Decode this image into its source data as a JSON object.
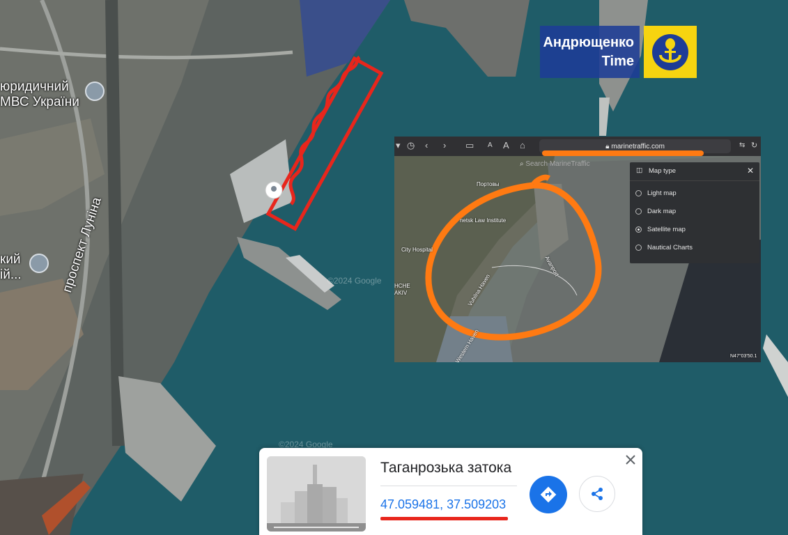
{
  "map": {
    "labels": {
      "institute_line1": "юридичний",
      "institute_line2": "МВС України",
      "partial_line1": "кий",
      "partial_line2": "ій...",
      "street": "проспект Луніна",
      "watermark": "©2024 Google"
    },
    "colors": {
      "water": "#1e5a66",
      "marker": "#e8261c",
      "orange_mark": "#ff7a12"
    }
  },
  "brand": {
    "line1": "Андрющенко",
    "line2": "Time",
    "logo_icon": "anchor-microphone-icon"
  },
  "screenshot": {
    "url": "marinetraffic.com",
    "search_placeholder": "Search MarineTraffic",
    "toolbar_font_small": "A",
    "toolbar_font_large": "A",
    "panel_title": "Map type",
    "options": [
      {
        "label": "Light map",
        "selected": false
      },
      {
        "label": "Dark map",
        "selected": false
      },
      {
        "label": "Satellite map",
        "selected": true
      },
      {
        "label": "Nautical Charts",
        "selected": false
      }
    ],
    "map_labels": {
      "portovyi": "Портовы",
      "law_institute": "netsk Law Institute",
      "hospital": "City Hospital",
      "nche": "НСНЕ",
      "akiv": "AKIV",
      "vuhilna": "Vuhilna Haven",
      "avanport": "Avanport",
      "western": "Western Haven",
      "watermark": "©2024 Google",
      "coord": "N47°03'50.1"
    }
  },
  "card": {
    "title": "Таганрозька затока",
    "coordinates": "47.059481, 37.509203",
    "directions_icon": "directions-icon",
    "share_icon": "share-icon",
    "close_icon": "close-icon"
  }
}
